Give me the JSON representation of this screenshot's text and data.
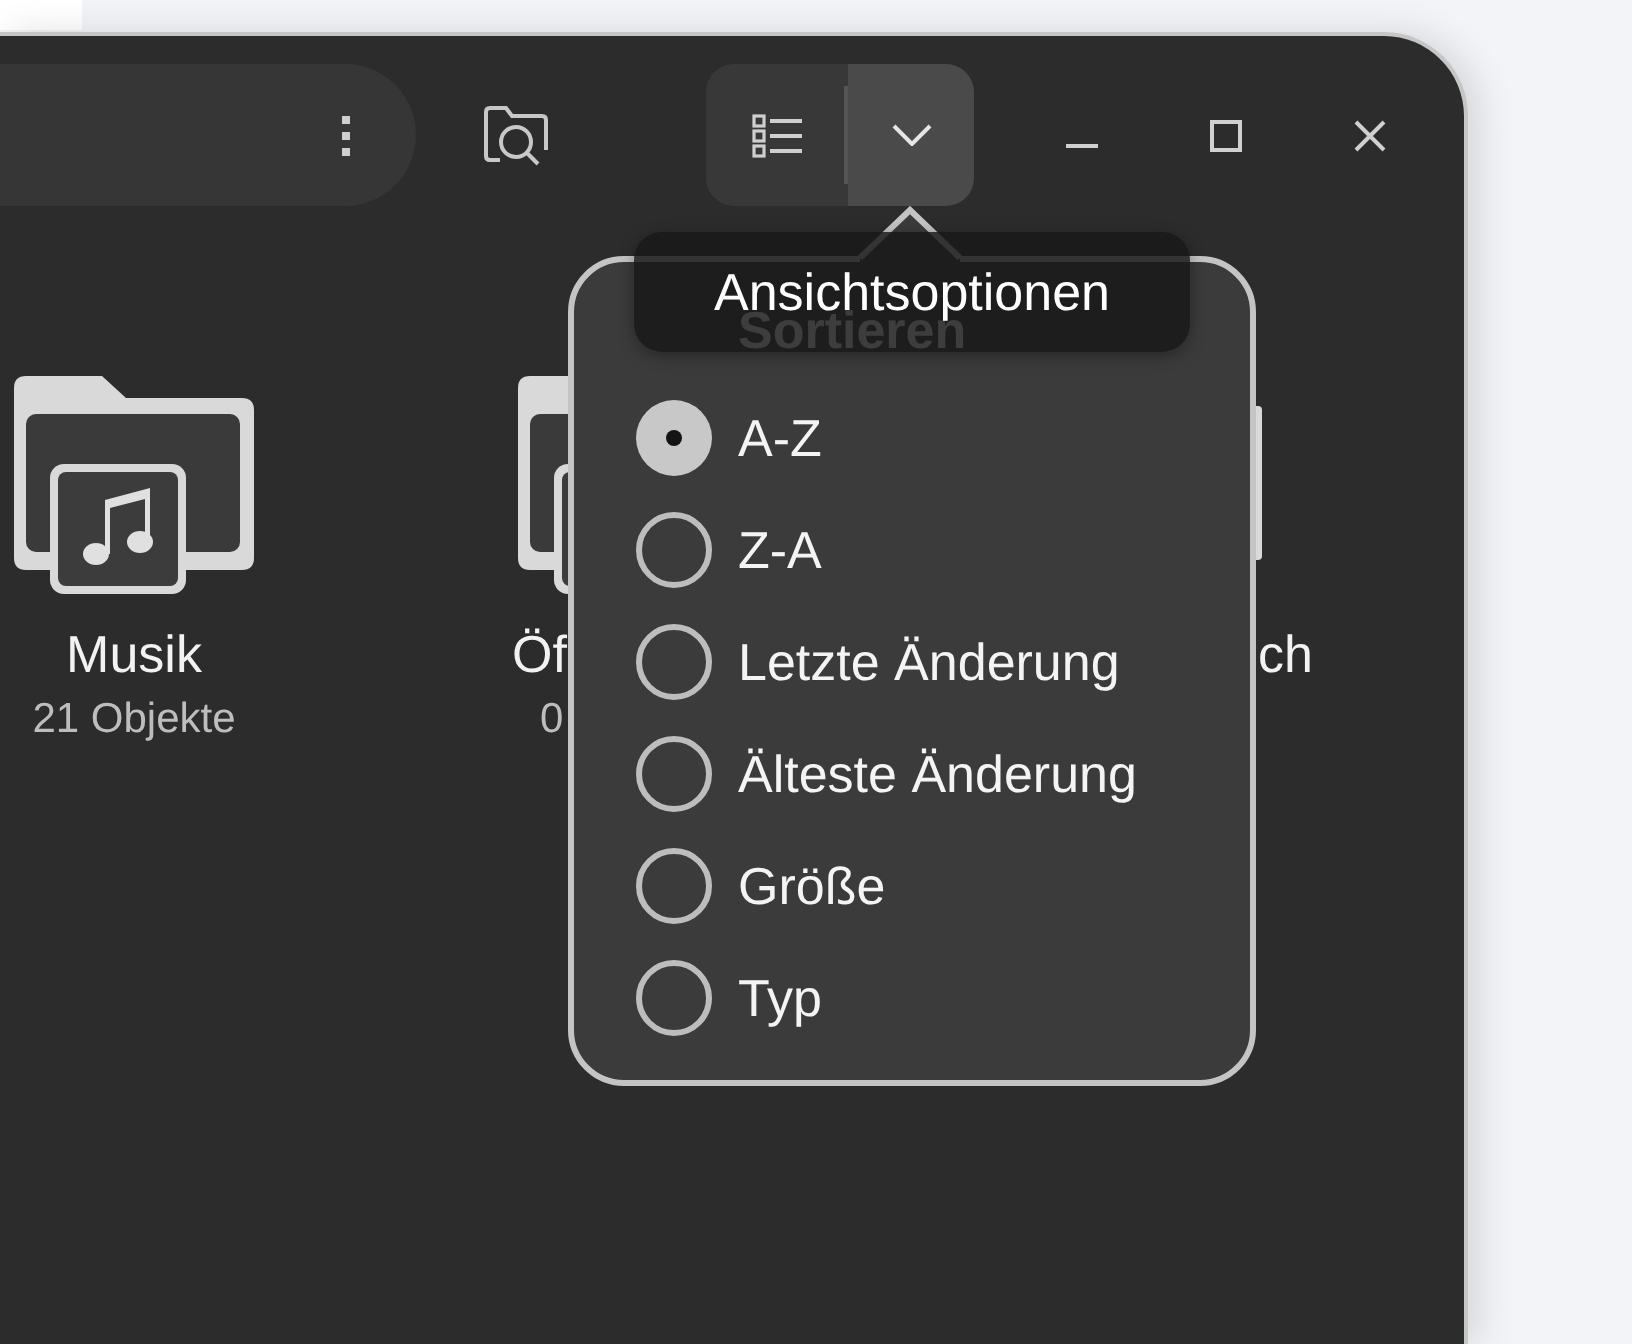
{
  "view_menu": {
    "expanded": true
  },
  "folders": [
    {
      "name": "Musik",
      "count": "21 Objekte"
    },
    {
      "name": "Öf",
      "count": "0"
    },
    {
      "name": "ch"
    }
  ],
  "tooltip": "Ansichtsoptionen",
  "popover": {
    "heading": "Sortieren",
    "options": [
      {
        "label": "A-Z",
        "selected": true
      },
      {
        "label": "Z-A",
        "selected": false
      },
      {
        "label": "Letzte Änderung",
        "selected": false
      },
      {
        "label": "Älteste Änderung",
        "selected": false
      },
      {
        "label": "Größe",
        "selected": false
      },
      {
        "label": "Typ",
        "selected": false
      }
    ]
  }
}
